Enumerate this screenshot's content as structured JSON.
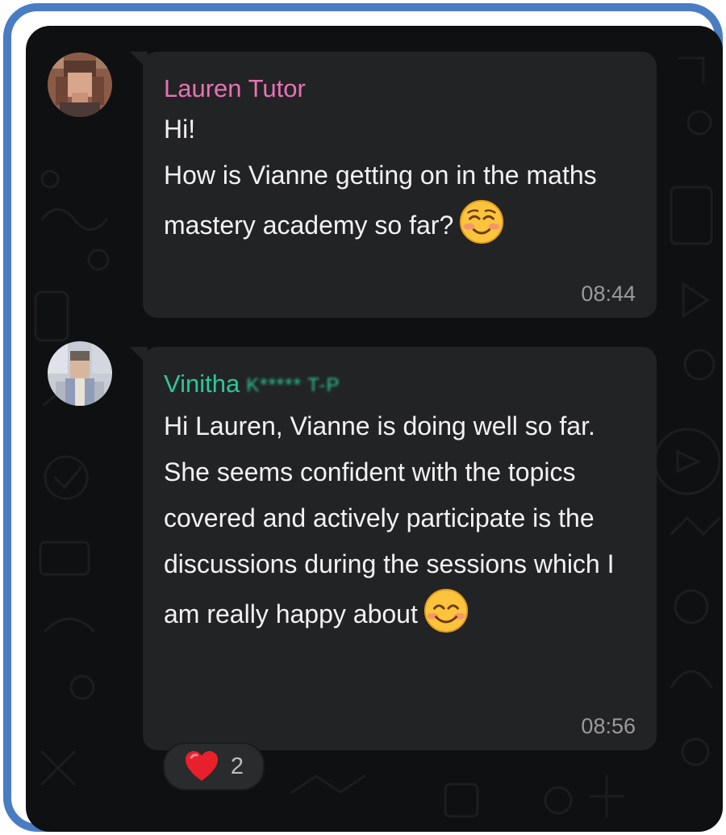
{
  "messages": [
    {
      "sender": "Lauren Tutor",
      "sender_color": "#e772b4",
      "text": "Hi!\nHow is Vianne getting on in the maths mastery academy so far?",
      "emoji": "smiling-face-with-blush",
      "time": "08:44",
      "avatar": "lauren-avatar"
    },
    {
      "sender": "Vinitha",
      "sender_color": "#2bc79a",
      "sender_suffix_redacted": "K***** T-P",
      "text": "Hi Lauren, Vianne is doing well so far. She seems confident with the topics covered and actively participate is the discussions during the sessions which I am really happy about",
      "emoji": "smiling-face-with-smiling-eyes",
      "time": "08:56",
      "avatar": "vinitha-avatar",
      "reaction": {
        "icon": "red-heart",
        "count": "2"
      }
    }
  ],
  "colors": {
    "frame_border": "#4a7cc2",
    "chat_background": "#0f1011",
    "bubble": "#222324"
  }
}
